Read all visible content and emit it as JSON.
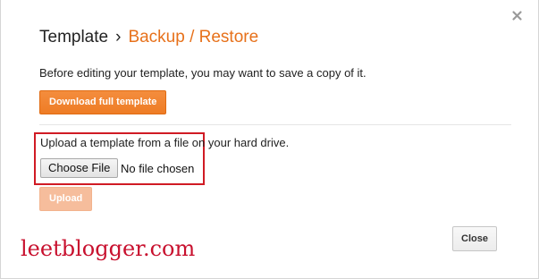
{
  "header": {
    "breadcrumb_parent": "Template",
    "breadcrumb_separator": "›",
    "breadcrumb_current": "Backup / Restore"
  },
  "backup": {
    "description": "Before editing your template, you may want to save a copy of it.",
    "download_label": "Download full template"
  },
  "restore": {
    "instructions": "Upload a template from a file on your hard drive.",
    "choose_file_label": "Choose File",
    "file_status": "No file chosen",
    "upload_label": "Upload",
    "upload_enabled": false
  },
  "footer": {
    "close_label": "Close"
  },
  "watermark": {
    "text": "leetblogger.com"
  },
  "icons": {
    "close": "close-icon"
  },
  "colors": {
    "accent": "#e7711b",
    "primary_button": "#f08330",
    "disabled_button": "#f6bd9c",
    "highlight_box": "#d01b24",
    "watermark": "#c8102e"
  }
}
